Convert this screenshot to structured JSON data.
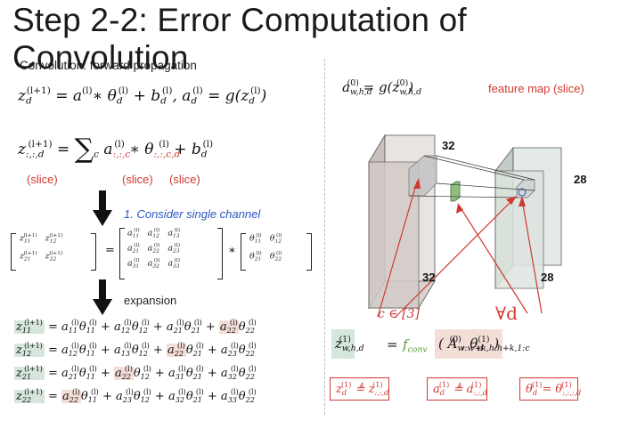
{
  "title": "Step 2-2: Error Computation of Convolution",
  "left": {
    "subtitle": "Convolution: forward propagation",
    "slice_label_1": "(slice)",
    "slice_label_2": "(slice)",
    "slice_label_3": "(slice)",
    "step_note": "1. Consider single channel",
    "expansion_label": "expansion"
  },
  "right": {
    "feature_map_label": "feature map (slice)",
    "dim_top": "32",
    "dim_right": "28",
    "dim_bottom_left": "32",
    "dim_bottom_right": "28",
    "channel_range": "c ∈ [3]",
    "forall_label": "∀d",
    "fconv": "f",
    "fconv_sub": "conv",
    "def_boxes": [
      "z_d^(1) ≜ z_{:,:,d}^(1)",
      "a_d^(1) ≜ a_{:,:,d}^(1)",
      "θ_d^(1)= θ_{:,:,:,d}^(1)"
    ]
  },
  "colors": {
    "accent_red": "#d0392f",
    "accent_blue": "#2a55c4",
    "highlight_green": "#d6e6dc",
    "highlight_pink": "#f3ddd6",
    "fconv_green": "#5a9a3a"
  }
}
